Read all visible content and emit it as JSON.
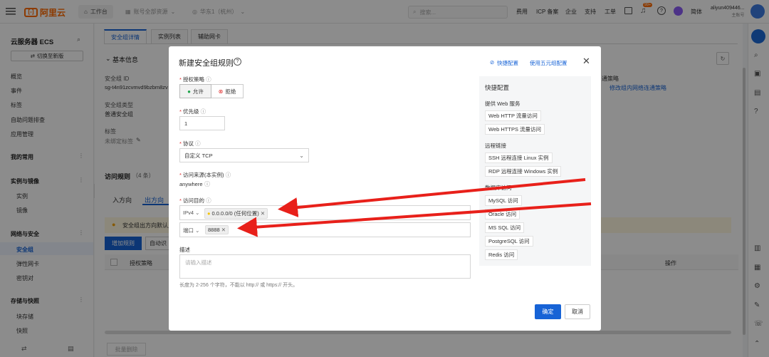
{
  "topbar": {
    "logo": "阿里云",
    "workbench": "工作台",
    "tab_account": "账号全部资源",
    "tab_region": "华东1（杭州）",
    "search_placeholder": "搜索...",
    "links": [
      "费用",
      "ICP 备案",
      "企业",
      "支持",
      "工单"
    ],
    "badge": "99+",
    "lang": "简体",
    "user_name": "aliyun409446...",
    "user_role": "主账号"
  },
  "nav": {
    "title": "云服务器 ECS",
    "switch_btn": "切换至新版",
    "items": [
      "概览",
      "事件",
      "标签",
      "自助问题排查",
      "应用管理"
    ],
    "sec_common": "我的常用",
    "sec_instance": "实例与镜像",
    "instance_items": [
      "实例",
      "镜像"
    ],
    "sec_network": "网络与安全",
    "network_items": [
      "安全组",
      "弹性网卡",
      "密钥对"
    ],
    "sec_storage": "存储与快照",
    "storage_items": [
      "块存储",
      "快照"
    ]
  },
  "main": {
    "tabs": [
      "安全组详情",
      "实例列表",
      "辅助网卡"
    ],
    "basic_info": "基本信息",
    "sg_id_label": "安全组 ID",
    "sg_id_value": "sg-t4n91zcvmvd9bzbm8zv",
    "sg_type_label": "安全组类型",
    "sg_type_value": "普通安全组",
    "tag_label": "标签",
    "tag_value": "未绑定标签",
    "policy_label": "通策略",
    "policy_link": "修改组内网络连通策略",
    "rules_title": "访问规则",
    "rules_count": "（4 条）",
    "sub_tabs": [
      "入方向",
      "出方向"
    ],
    "notice": "安全组出方向默认允",
    "add_rule": "增加规则",
    "auto_btn": "自动识",
    "col_policy": "授权策略",
    "col_action": "操作",
    "bulk_delete": "批量删除"
  },
  "modal": {
    "title": "新建安全组规则",
    "quick_config": "快捷配置",
    "use_five_tuple": "使用五元组配置",
    "policy_label": "授权策略",
    "allow": "允许",
    "deny": "拒绝",
    "priority_label": "优先级",
    "priority_value": "1",
    "protocol_label": "协议",
    "protocol_value": "自定义 TCP",
    "source_label": "访问来源(本实例)",
    "source_value": "anywhere",
    "dest_label": "访问目的",
    "dest_type": "IPv4",
    "dest_chip": "0.0.0.0/0 (任何位置)",
    "port_type": "端口",
    "port_chip": "8888",
    "desc_label": "描述",
    "desc_placeholder": "请输入描述",
    "desc_hint": "长度为 2-256 个字符，不能以 http:// 或 https:// 开头。",
    "ok": "确定",
    "cancel": "取消"
  },
  "quick": {
    "title": "快捷配置",
    "sec_web": "提供 Web 服务",
    "web_btns": [
      "Web HTTP 流量访问",
      "Web HTTPS 流量访问"
    ],
    "sec_remote": "远程链接",
    "remote_btns": [
      "SSH 远程连接 Linux 实例",
      "RDP 远程连接 Windows 实例"
    ],
    "sec_db": "数据库访问",
    "db_btns": [
      "MySQL 访问",
      "Oracle 访问",
      "MS SQL 访问",
      "PostgreSQL 访问",
      "Redis 访问"
    ]
  },
  "colors": {
    "accent": "#1763d6",
    "brand": "#ff6a00",
    "arrow": "#e8201a"
  }
}
